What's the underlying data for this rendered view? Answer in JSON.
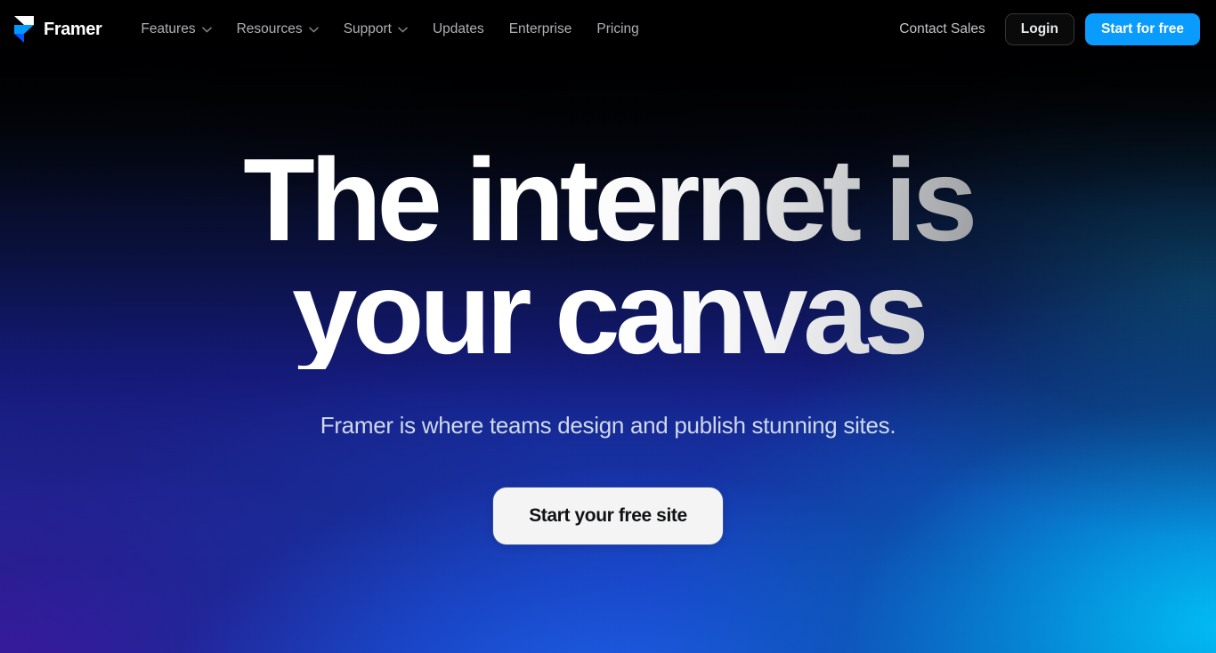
{
  "nav": {
    "brand": {
      "name": "Framer",
      "logo_icon": "framer-logo-icon"
    },
    "links": [
      {
        "label": "Features",
        "has_chevron": true,
        "icon": "chevron-down-icon"
      },
      {
        "label": "Resources",
        "has_chevron": true,
        "icon": "chevron-down-icon"
      },
      {
        "label": "Support",
        "has_chevron": true,
        "icon": "chevron-down-icon"
      },
      {
        "label": "Updates",
        "has_chevron": false,
        "icon": ""
      },
      {
        "label": "Enterprise",
        "has_chevron": false,
        "icon": ""
      },
      {
        "label": "Pricing",
        "has_chevron": false,
        "icon": ""
      }
    ],
    "contact_sales_label": "Contact Sales",
    "login_label": "Login",
    "start_free_label": "Start for free"
  },
  "hero": {
    "headline_line_1": "The internet is",
    "headline_line_2": "your canvas",
    "subheadline": "Framer is where teams design and publish stunning sites.",
    "cta_label": "Start your free site"
  },
  "colors": {
    "accent_blue": "#0A9BFF",
    "nav_background": "#000000",
    "nav_link": "#AEB0B3",
    "login_border": "#333538",
    "cta_background": "#F4F4F4",
    "cta_text": "#111214",
    "subheadline_text": "#CFD8E8",
    "gradient_purple": "#460A96",
    "gradient_blue": "#1E5FE6",
    "gradient_cyan": "#00BEF5",
    "logo_blue": "#0055FF",
    "logo_white": "#FFFFFF"
  }
}
